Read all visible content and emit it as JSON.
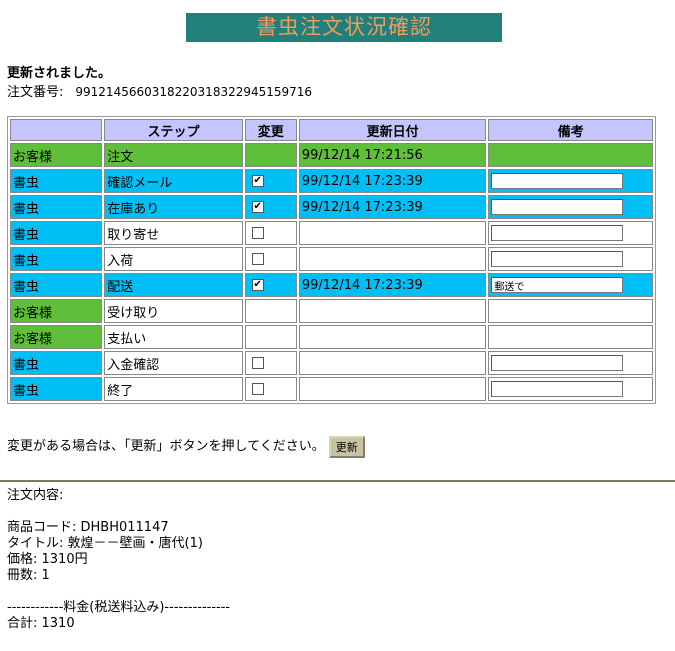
{
  "banner": {
    "title": "書虫注文状況確認"
  },
  "message": "更新されました。",
  "order": {
    "label": "注文番号:",
    "number": "9912145660318220318322945159716"
  },
  "table": {
    "headers": [
      "",
      "ステップ",
      "変更",
      "更新日付",
      "備考"
    ],
    "rows": [
      {
        "actor": "お客様",
        "step": "注文",
        "checkbox": null,
        "date": "99/12/14 17:21:56",
        "note": null,
        "actor_color": "green",
        "row_color": "green"
      },
      {
        "actor": "書虫",
        "step": "確認メール",
        "checkbox": true,
        "date": "99/12/14 17:23:39",
        "note": "",
        "actor_color": "cyan",
        "row_color": "cyan"
      },
      {
        "actor": "書虫",
        "step": "在庫あり",
        "checkbox": true,
        "date": "99/12/14 17:23:39",
        "note": "",
        "actor_color": "cyan",
        "row_color": "cyan"
      },
      {
        "actor": "書虫",
        "step": "取り寄せ",
        "checkbox": false,
        "date": "",
        "note": "",
        "actor_color": "cyan",
        "row_color": "white"
      },
      {
        "actor": "書虫",
        "step": "入荷",
        "checkbox": false,
        "date": "",
        "note": "",
        "actor_color": "cyan",
        "row_color": "white"
      },
      {
        "actor": "書虫",
        "step": "配送",
        "checkbox": true,
        "date": "99/12/14 17:23:39",
        "note": "郵送で",
        "actor_color": "cyan",
        "row_color": "cyan"
      },
      {
        "actor": "お客様",
        "step": "受け取り",
        "checkbox": null,
        "date": "",
        "note": null,
        "actor_color": "green",
        "row_color": "white"
      },
      {
        "actor": "お客様",
        "step": "支払い",
        "checkbox": null,
        "date": "",
        "note": null,
        "actor_color": "green",
        "row_color": "white"
      },
      {
        "actor": "書虫",
        "step": "入金確認",
        "checkbox": false,
        "date": "",
        "note": "",
        "actor_color": "cyan",
        "row_color": "white"
      },
      {
        "actor": "書虫",
        "step": "終了",
        "checkbox": false,
        "date": "",
        "note": "",
        "actor_color": "cyan",
        "row_color": "white"
      }
    ]
  },
  "hint": {
    "text": "変更がある場合は、「更新」ボタンを押してください。",
    "button_label": "更新"
  },
  "details": {
    "heading": "注文内容:",
    "lines": [
      "",
      "商品コード: DHBH011147",
      "タイトル: 敦煌－－壁画・唐代(1)",
      "価格: 1310円",
      "冊数: 1",
      "",
      "------------料金(税送料込み)--------------",
      "合計: 1310"
    ]
  },
  "colors": {
    "banner_bg": "#1f807c",
    "banner_text": "#f49a5a",
    "header_bg": "#c4c4ff",
    "green": "#5fbe3a",
    "cyan": "#00bff4",
    "button_bg": "#c9c3a6"
  }
}
